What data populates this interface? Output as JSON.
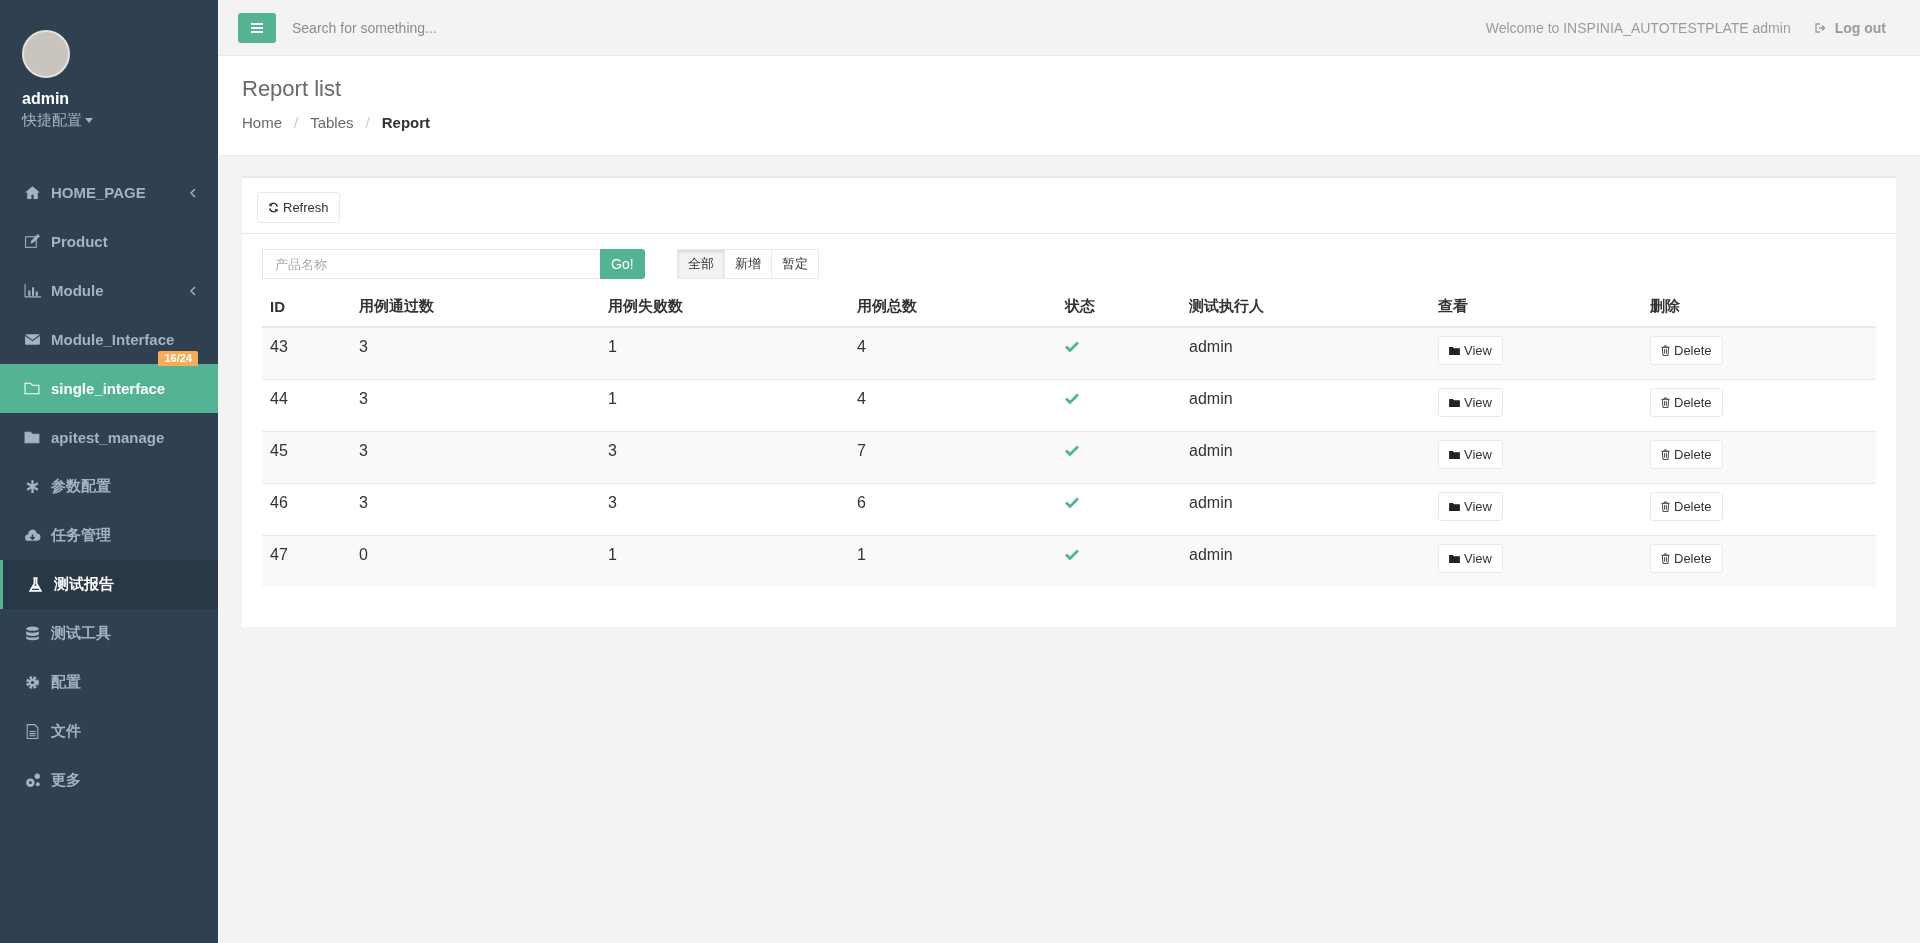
{
  "sidebar": {
    "user": {
      "name": "admin",
      "menu_label": "快捷配置"
    },
    "items": [
      {
        "label": "HOME_PAGE",
        "expandable": true,
        "hovered": false,
        "selected": false
      },
      {
        "label": "Product",
        "expandable": false,
        "hovered": false,
        "selected": false
      },
      {
        "label": "Module",
        "expandable": true,
        "hovered": false,
        "selected": false
      },
      {
        "label": "Module_Interface",
        "expandable": false,
        "hovered": false,
        "selected": false,
        "badge": "16/24"
      },
      {
        "label": "single_interface",
        "expandable": false,
        "hovered": true,
        "selected": false
      },
      {
        "label": "apitest_manage",
        "expandable": false,
        "hovered": false,
        "selected": false
      },
      {
        "label": "参数配置",
        "expandable": false,
        "hovered": false,
        "selected": false
      },
      {
        "label": "任务管理",
        "expandable": false,
        "hovered": false,
        "selected": false
      },
      {
        "label": "测试报告",
        "expandable": false,
        "hovered": false,
        "selected": true
      },
      {
        "label": "测试工具",
        "expandable": false,
        "hovered": false,
        "selected": false
      },
      {
        "label": "配置",
        "expandable": false,
        "hovered": false,
        "selected": false
      },
      {
        "label": "文件",
        "expandable": false,
        "hovered": false,
        "selected": false
      },
      {
        "label": "更多",
        "expandable": false,
        "hovered": false,
        "selected": false
      }
    ]
  },
  "topbar": {
    "search": {
      "placeholder": "Search for something..."
    },
    "welcome": "Welcome to INSPINIA_AUTOTESTPLATE admin",
    "logout": "Log out"
  },
  "page_heading": {
    "title": "Report list",
    "separator": "/",
    "breadcrumb": [
      {
        "label": "Home",
        "current": false
      },
      {
        "label": "Tables",
        "current": false
      },
      {
        "label": "Report",
        "current": true
      }
    ]
  },
  "card": {
    "refresh_button": "Refresh",
    "filter": {
      "placeholder": "产品名称",
      "go_button": "Go!"
    },
    "status_filter": [
      {
        "label": "全部",
        "selected": true
      },
      {
        "label": "新增",
        "selected": false
      },
      {
        "label": "暂定",
        "selected": false
      }
    ],
    "table": {
      "columns": [
        "ID",
        "用例通过数",
        "用例失败数",
        "用例总数",
        "状态",
        "测试执行人",
        "查看",
        "删除"
      ],
      "rows": [
        {
          "id": "43",
          "passed": "3",
          "failed": "1",
          "total": "4",
          "ok": true,
          "executor": "admin",
          "view": "View",
          "delete": "Delete"
        },
        {
          "id": "44",
          "passed": "3",
          "failed": "1",
          "total": "4",
          "ok": true,
          "executor": "admin",
          "view": "View",
          "delete": "Delete"
        },
        {
          "id": "45",
          "passed": "3",
          "failed": "3",
          "total": "7",
          "ok": true,
          "executor": "admin",
          "view": "View",
          "delete": "Delete"
        },
        {
          "id": "46",
          "passed": "3",
          "failed": "3",
          "total": "6",
          "ok": true,
          "executor": "admin",
          "view": "View",
          "delete": "Delete"
        },
        {
          "id": "47",
          "passed": "0",
          "failed": "1",
          "total": "1",
          "ok": true,
          "executor": "admin",
          "view": "View",
          "delete": "Delete"
        }
      ]
    }
  }
}
